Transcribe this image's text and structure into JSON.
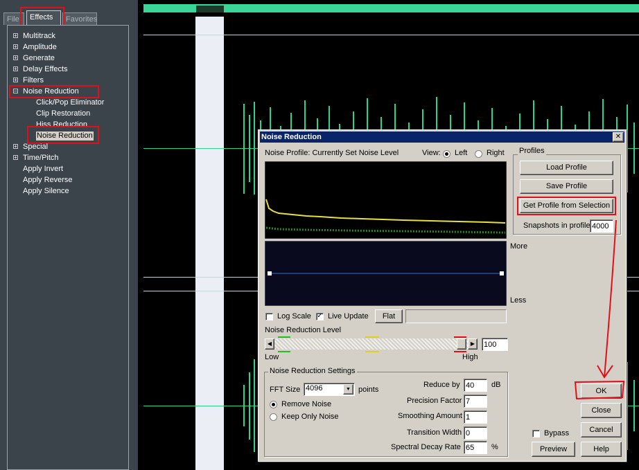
{
  "tabs": {
    "file": "File",
    "effects": "Effects",
    "favorites": "Favorites"
  },
  "tree": {
    "multitrack": "Multitrack",
    "amplitude": "Amplitude",
    "generate": "Generate",
    "delay": "Delay Effects",
    "filters": "Filters",
    "noise_reduction": "Noise Reduction",
    "click_pop": "Click/Pop Eliminator",
    "clip_restoration": "Clip Restoration",
    "hiss_reduction": "Hiss Reduction",
    "noise_reduction_item": "Noise Reduction",
    "special": "Special",
    "time_pitch": "Time/Pitch",
    "apply_invert": "Apply Invert",
    "apply_reverse": "Apply Reverse",
    "apply_silence": "Apply Silence"
  },
  "dialog": {
    "title": "Noise Reduction",
    "profile_label": "Noise Profile: Currently Set Noise Level",
    "view_label": "View:",
    "view_left": "Left",
    "view_right": "Right",
    "more": "More",
    "less": "Less",
    "log_scale": "Log Scale",
    "live_update": "Live Update",
    "flat": "Flat",
    "nr_level_label": "Noise Reduction Level",
    "low": "Low",
    "high": "High",
    "nr_level_value": "100",
    "nr_level_fraction": 1.0,
    "settings_title": "Noise Reduction Settings",
    "fft_label": "FFT Size",
    "fft_value": "4096",
    "points": "points",
    "remove_noise": "Remove Noise",
    "keep_only_noise": "Keep Only Noise",
    "reduce_by_label": "Reduce by",
    "reduce_by": "40",
    "db": "dB",
    "precision_label": "Precision Factor",
    "precision": "7",
    "smoothing_label": "Smoothing Amount",
    "smoothing": "1",
    "transition_label": "Transition Width",
    "transition": "0",
    "decay_label": "Spectral Decay Rate",
    "decay": "65",
    "percent": "%",
    "profiles_title": "Profiles",
    "load_profile": "Load Profile",
    "save_profile": "Save Profile",
    "get_profile": "Get Profile from Selection",
    "snapshots_label": "Snapshots in profile",
    "snapshots": "4000",
    "ok": "OK",
    "close": "Close",
    "cancel": "Cancel",
    "help": "Help",
    "bypass": "Bypass",
    "preview": "Preview",
    "close_x": "✕"
  },
  "colors": {
    "accent_red": "#e0101a",
    "wave_green": "#2fd48a",
    "title_blue": "#0a246a"
  }
}
